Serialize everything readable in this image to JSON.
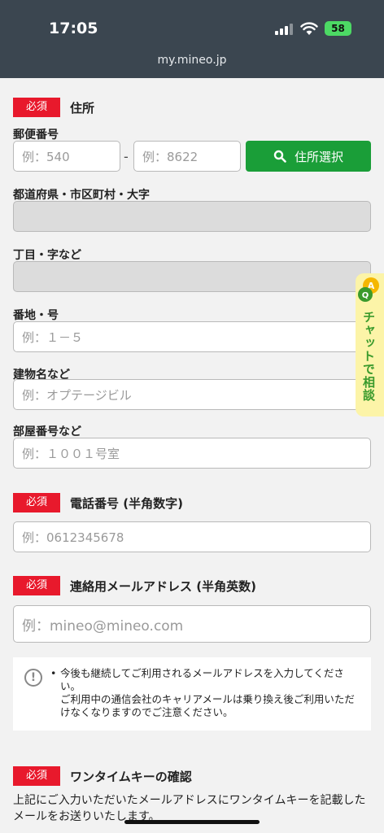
{
  "status": {
    "time": "17:05",
    "battery": "58",
    "url": "my.mineo.jp"
  },
  "address": {
    "required": "必須",
    "title": "住所",
    "postal_label": "郵便番号",
    "postal1_placeholder": "例：540",
    "postal_dash": "-",
    "postal2_placeholder": "例：8622",
    "search_button": "住所選択",
    "pref_label": "都道府県・市区町村・大字",
    "chome_label": "丁目・字など",
    "banchi_label": "番地・号",
    "banchi_placeholder": "例：１－５",
    "building_label": "建物名など",
    "building_placeholder": "例：オプテージビル",
    "room_label": "部屋番号など",
    "room_placeholder": "例：１００１号室"
  },
  "phone": {
    "required": "必須",
    "title": "電話番号 (半角数字)",
    "placeholder": "例：0612345678"
  },
  "email": {
    "required": "必須",
    "title": "連絡用メールアドレス (半角英数)",
    "placeholder": "例：mineo@mineo.com",
    "note_icon": "!",
    "note_bullet": "•",
    "note_line1": "今後も継続してご利用されるメールアドレスを入力してください。",
    "note_line2": "ご利用中の通信会社のキャリアメールは乗り換え後ご利用いただけなくなりますのでご注意ください。"
  },
  "onetime": {
    "required": "必須",
    "title": "ワンタイムキーの確認",
    "description": "上記にご入力いただいたメールアドレスにワンタイムキーを記載したメールをお送りいたします。"
  },
  "chat": {
    "text": "チャットで相談",
    "icon": "qa-chat-icon"
  },
  "colors": {
    "required_bg": "#e8192c",
    "search_green": "#1a9e38",
    "chat_bg": "#fcf4a8",
    "status_bg": "#3b4650"
  }
}
